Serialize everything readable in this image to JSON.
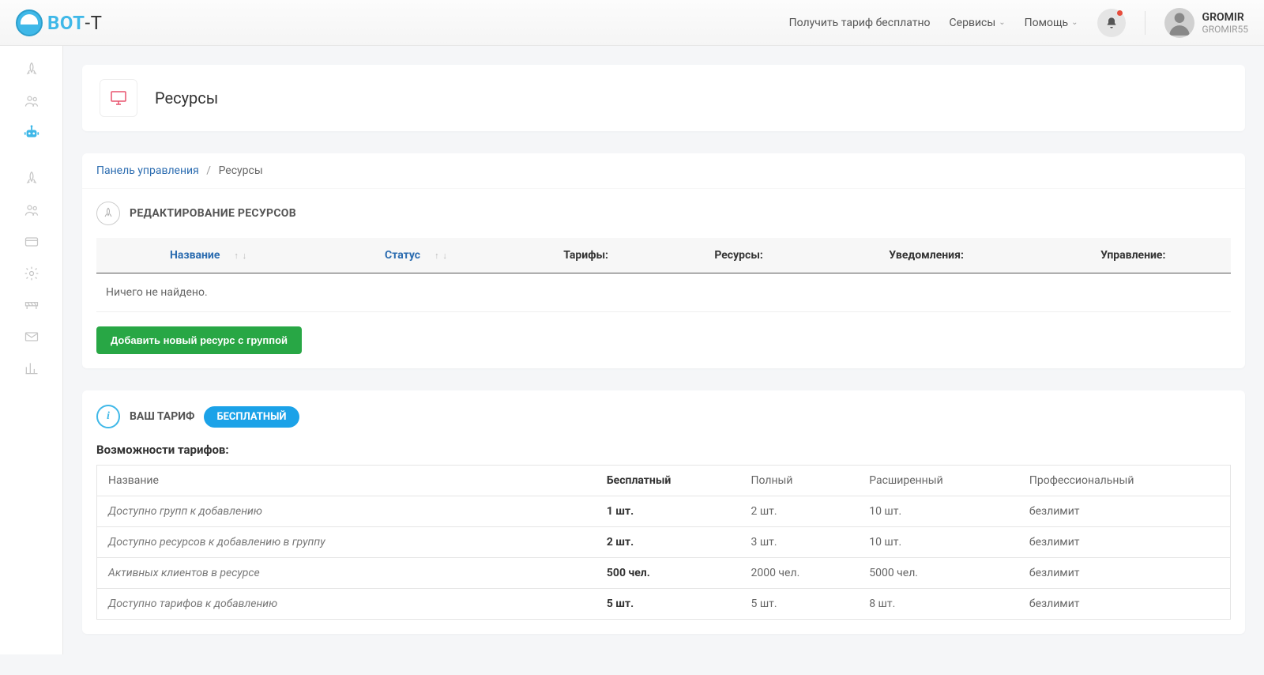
{
  "header": {
    "logo_text": "BOT",
    "logo_suffix": "-T",
    "links": {
      "free_tariff": "Получить тариф бесплатно",
      "services": "Сервисы",
      "help": "Помощь"
    },
    "user": {
      "name": "GROMIR",
      "sub": "GROMIR55"
    }
  },
  "page": {
    "title": "Ресурсы"
  },
  "breadcrumb": {
    "root": "Панель управления",
    "current": "Ресурсы"
  },
  "section": {
    "edit_title": "РЕДАКТИРОВАНИЕ РЕСУРСОВ"
  },
  "res_columns": {
    "name": "Название",
    "status": "Статус",
    "tariffs": "Тарифы:",
    "resources": "Ресурсы:",
    "notifications": "Уведомления:",
    "manage": "Управление:"
  },
  "res_empty": "Ничего не найдено.",
  "add_button": "Добавить новый ресурс с группой",
  "tariff": {
    "label": "ВАШ ТАРИФ",
    "current": "БЕСПЛАТНЫЙ",
    "features_title": "Возможности тарифов:"
  },
  "feat_columns": {
    "name": "Название",
    "free": "Бесплатный",
    "full": "Полный",
    "ext": "Расширенный",
    "pro": "Профессиональный"
  },
  "feat_rows": [
    {
      "label": "Доступно групп к добавлению",
      "free": "1 шт.",
      "full": "2 шт.",
      "ext": "10 шт.",
      "pro": "безлимит"
    },
    {
      "label": "Доступно ресурсов к добавлению в группу",
      "free": "2 шт.",
      "full": "3 шт.",
      "ext": "10 шт.",
      "pro": "безлимит"
    },
    {
      "label": "Активных клиентов в ресурсе",
      "free": "500 чел.",
      "full": "2000 чел.",
      "ext": "5000 чел.",
      "pro": "безлимит"
    },
    {
      "label": "Доступно тарифов к добавлению",
      "free": "5 шт.",
      "full": "5 шт.",
      "ext": "8 шт.",
      "pro": "безлимит"
    }
  ]
}
